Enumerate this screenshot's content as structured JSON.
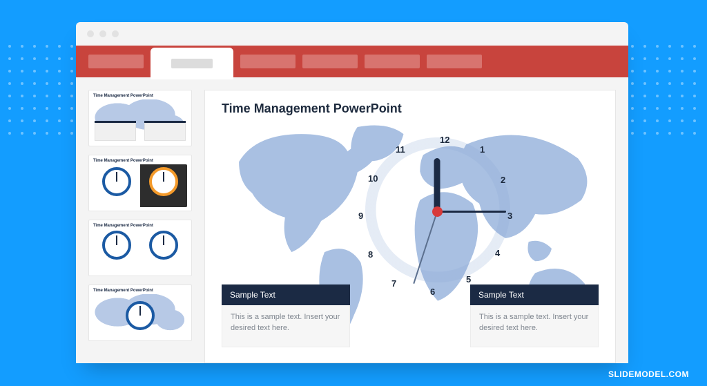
{
  "slide": {
    "title": "Time Management PowerPoint",
    "clock": {
      "n12": "12",
      "n1": "1",
      "n2": "2",
      "n3": "3",
      "n4": "4",
      "n5": "5",
      "n6": "6",
      "n7": "7",
      "n8": "8",
      "n9": "9",
      "n10": "10",
      "n11": "11"
    },
    "box_left": {
      "heading": "Sample Text",
      "body": "This is a sample text. Insert your desired text here."
    },
    "box_right": {
      "heading": "Sample Text",
      "body": "This is a sample text. Insert your desired text here."
    }
  },
  "thumbs": {
    "t1_title": "Time Management PowerPoint",
    "t2_title": "Time Management PowerPoint",
    "t3_title": "Time Management PowerPoint",
    "t4_title": "Time Management PowerPoint"
  },
  "watermark": "SLIDEMODEL.COM"
}
